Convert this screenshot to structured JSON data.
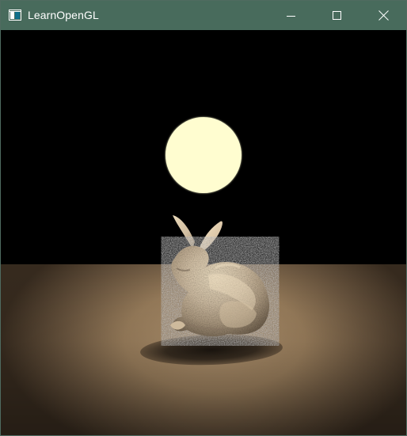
{
  "window": {
    "title": "LearnOpenGL",
    "background_color": "#000000",
    "titlebar_color": "#486B5C"
  },
  "icons": {
    "app": "window-app-icon",
    "minimize": "minimize-icon",
    "maximize": "maximize-icon",
    "close": "close-icon"
  },
  "scene": {
    "light_color": "#FFFDD0",
    "floor_color": "#AE916E",
    "bunny_color": "#DFCDB2"
  }
}
